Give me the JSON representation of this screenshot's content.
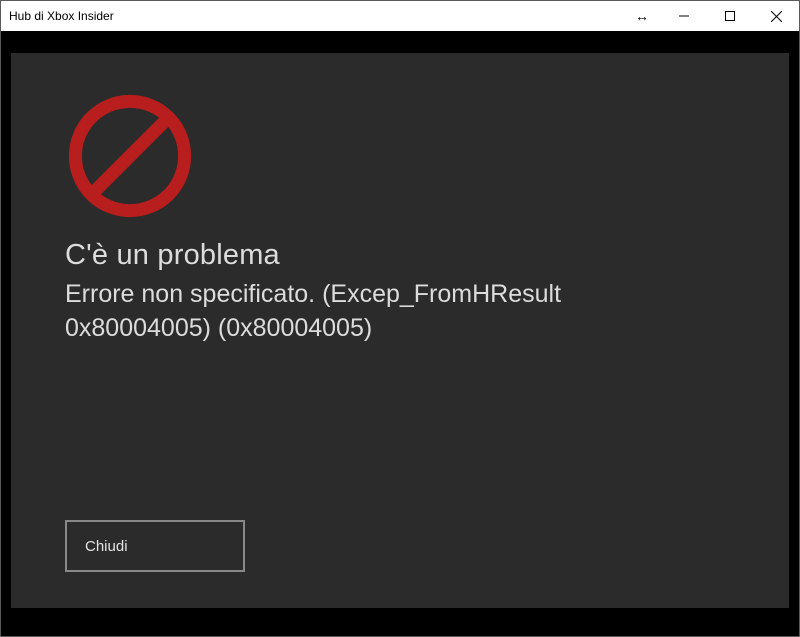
{
  "window": {
    "title": "Hub di Xbox Insider"
  },
  "error": {
    "heading": "C'è un problema",
    "message": "Errore non specificato. (Excep_FromHResult 0x80004005) (0x80004005)"
  },
  "buttons": {
    "close": "Chiudi"
  },
  "colors": {
    "panel_bg": "#2b2b2b",
    "outer_bg": "#000000",
    "error_icon": "#b81e1e",
    "text": "#dcdcdc"
  }
}
